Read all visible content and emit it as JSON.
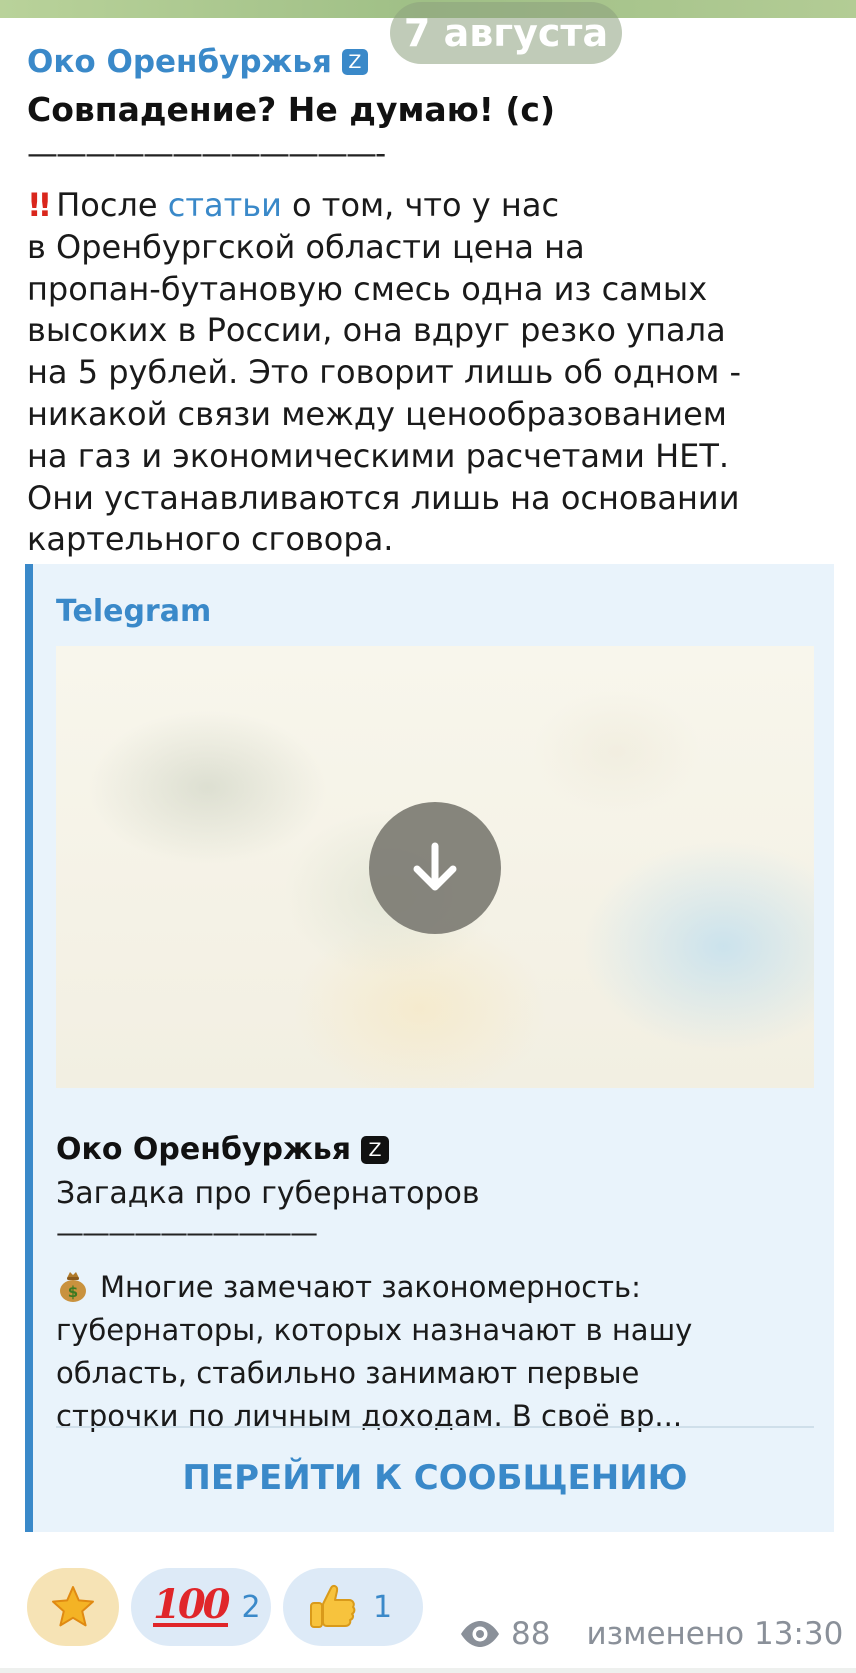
{
  "date_pill": "7 августа",
  "post": {
    "channel_name": "Око Оренбуржья",
    "badge": "Z",
    "title": "Совпадение? Не думаю! (с)",
    "separator": "————————————-",
    "body": {
      "alarm_icon": "double-exclamation-icon",
      "lead_before": "После ",
      "link_text": "статьи",
      "lead_after": " о том, что у нас",
      "lines": [
        "в Оренбургской области цена на",
        "пропан-бутановую смесь одна из самых",
        "высоких в России, она вдруг резко упала",
        "на 5 рублей. Это говорит лишь об одном -",
        "никакой связи между ценообразованием",
        "на газ и экономическими расчетами НЕТ.",
        "Они устанавливаются лишь на основании",
        "картельного сговора."
      ]
    }
  },
  "preview": {
    "site": "Telegram",
    "author": "Око Оренбуржья",
    "badge": "Z",
    "subtitle": "Загадка про губернаторов",
    "separator": "——————————",
    "money_icon": "money-bag-icon",
    "text_lines": [
      "Многие замечают закономерность:",
      "губернаторы, которых назначают в нашу",
      "область, стабильно занимают первые",
      "строчки по личным доходам. В своё вр..."
    ],
    "button_label": "ПЕРЕЙТИ К СООБЩЕНИЮ",
    "download_icon": "download-arrow-icon"
  },
  "reactions": [
    {
      "icon": "star-icon",
      "count": ""
    },
    {
      "icon": "hundred-points-icon",
      "glyph": "100",
      "count": "2"
    },
    {
      "icon": "thumbs-up-icon",
      "count": "1"
    }
  ],
  "meta": {
    "views_icon": "eye-icon",
    "views": "88",
    "edited": "изменено 13:30"
  },
  "colors": {
    "accent": "#3a89c9",
    "preview_bg": "#e9f3fb",
    "reaction_bg": "#ddeaf7",
    "star_reaction_bg": "#f6e3b5",
    "alarm": "#d9261c",
    "meta_text": "#8a9099"
  }
}
